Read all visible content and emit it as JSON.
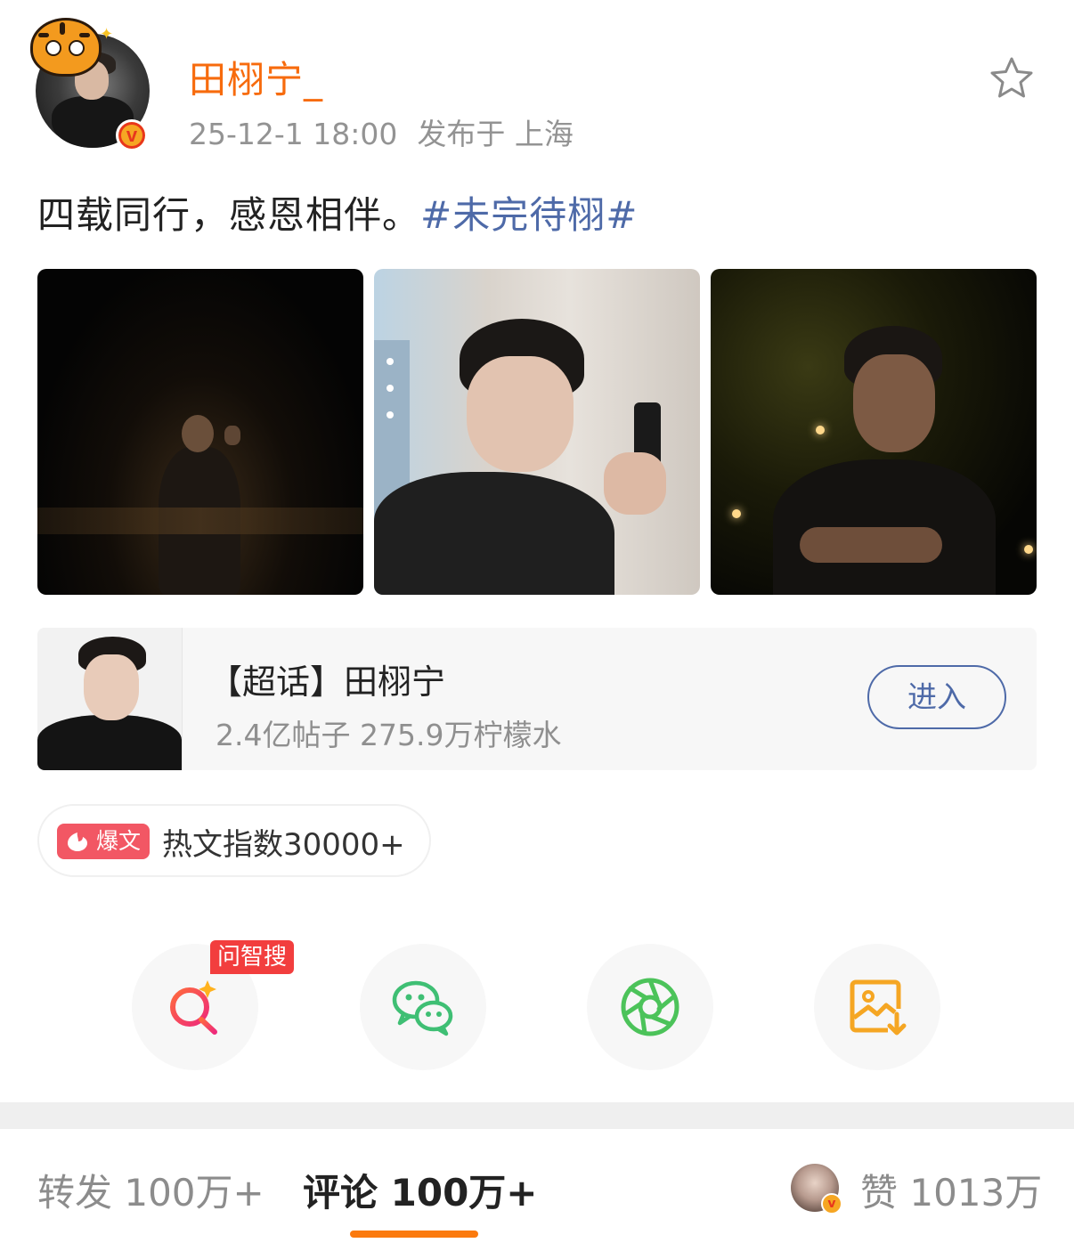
{
  "post": {
    "username": "田栩宁_",
    "time": "25-12-1 18:00",
    "location": "发布于 上海",
    "text": "四载同行，感恩相伴。",
    "hashtag": "#未完待栩#"
  },
  "topic": {
    "title": "【超话】田栩宁",
    "stats": "2.4亿帖子 275.9万柠檬水",
    "enter_label": "进入"
  },
  "hot": {
    "tag": "爆文",
    "text": "热文指数30000+"
  },
  "share": {
    "ai_badge": "问智搜",
    "icons": [
      "ai-search-icon",
      "wechat-icon",
      "moments-icon",
      "save-image-icon"
    ]
  },
  "tabs": {
    "repost": "转发 100万+",
    "comment": "评论 100万+",
    "like": "赞 1013万"
  },
  "colors": {
    "username": "#f76b0d",
    "hashtag": "#4e6aa8",
    "tab_indicator": "#fb7a0e",
    "hot_tag": "#f25764"
  }
}
